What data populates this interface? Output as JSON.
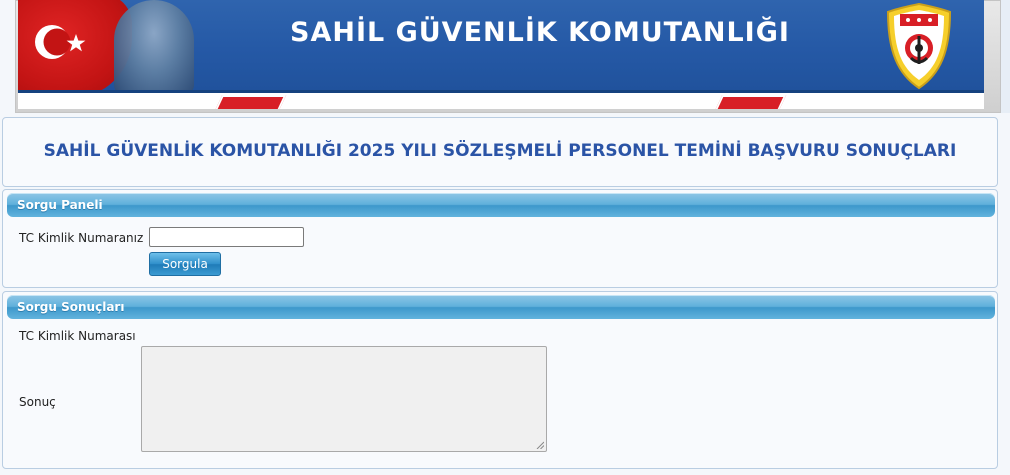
{
  "banner": {
    "title": "SAHİL GÜVENLİK KOMUTANLIĞI",
    "flag_icon": "turkish-flag-icon",
    "emblem_icon": "coast-guard-emblem-icon",
    "colors": {
      "banner_blue": "#2559a6",
      "flag_red": "#c31414",
      "stripe_red": "#d81f26"
    }
  },
  "page": {
    "title": "SAHİL GÜVENLİK KOMUTANLIĞI 2025 YILI SÖZLEŞMELİ PERSONEL TEMİNİ BAŞVURU SONUÇLARI",
    "title_color": "#2b54a6"
  },
  "query_panel": {
    "header": "Sorgu Paneli",
    "tc_label": "TC Kimlik Numaranız",
    "tc_value": "",
    "button_label": "Sorgula"
  },
  "results_panel": {
    "header": "Sorgu Sonuçları",
    "tc_label": "TC Kimlik Numarası",
    "result_label": "Sonuç",
    "result_value": ""
  }
}
